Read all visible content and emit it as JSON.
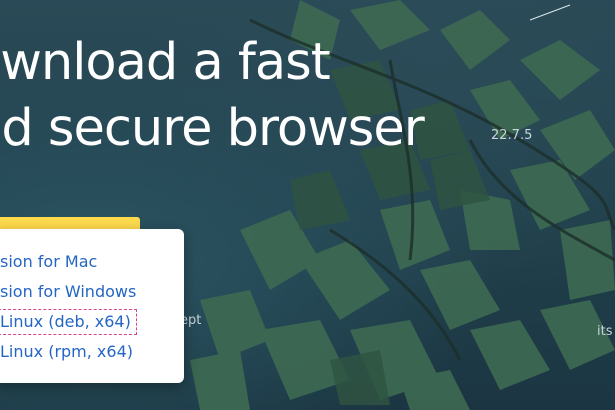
{
  "hero": {
    "title_line1": "ownload a fast",
    "title_line2": "nd secure browser",
    "version": "22.7.5"
  },
  "download_menu": {
    "items": [
      {
        "label": "sion for Mac"
      },
      {
        "label": "sion for Windows"
      },
      {
        "label": "Linux (deb, x64)"
      },
      {
        "label": "Linux (rpm, x64)"
      }
    ]
  },
  "side_texts": {
    "left": "ept",
    "right": "its"
  },
  "colors": {
    "accent_yellow": "#ffdb4d",
    "link_blue": "#2466c5",
    "focus_outline": "#d6458a"
  }
}
